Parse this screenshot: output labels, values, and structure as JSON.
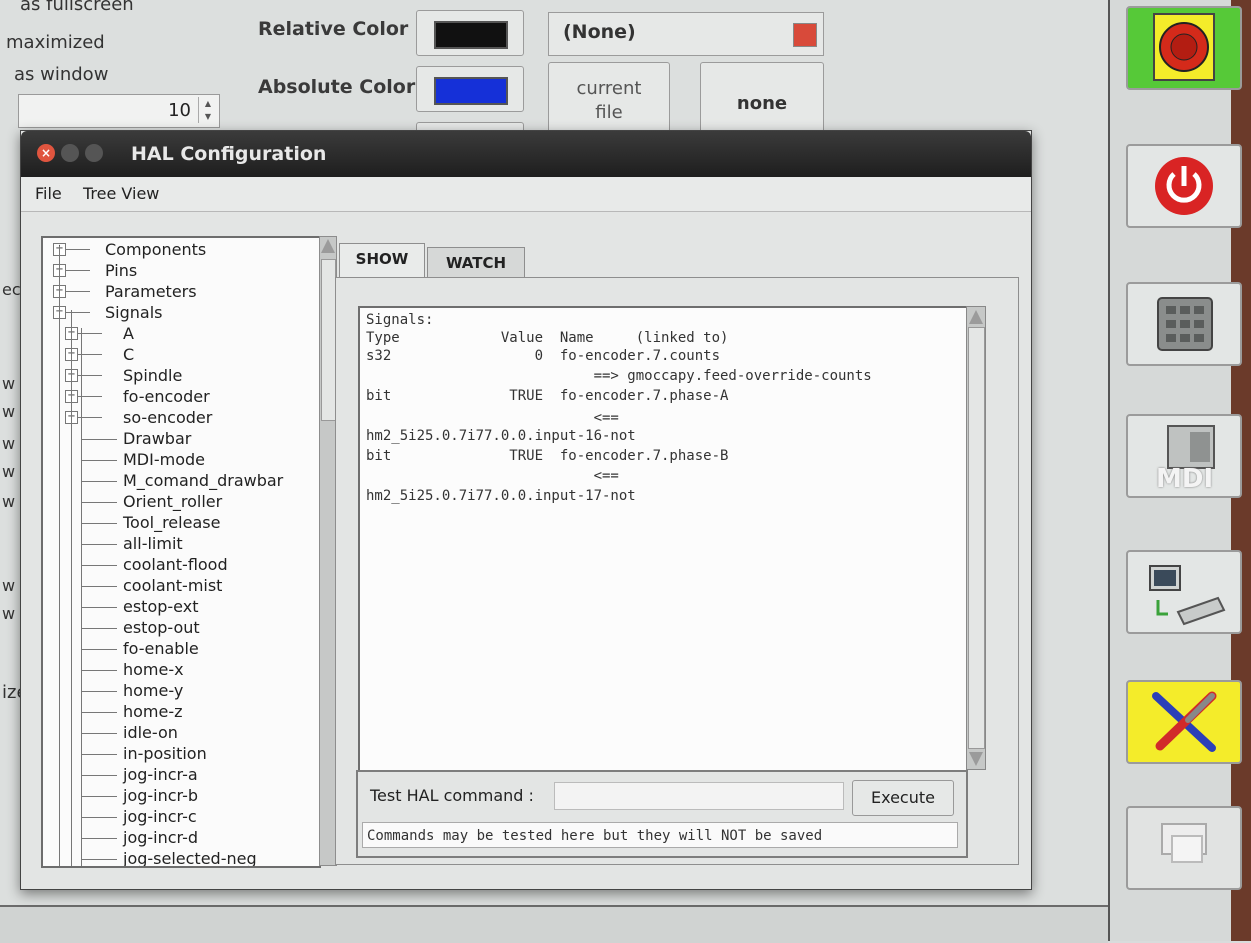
{
  "background": {
    "options": [
      "as fullscreen",
      "maximized",
      "as window"
    ],
    "spin_value": "10",
    "relative_color_label": "Relative Color",
    "absolute_color_label": "Absolute Color",
    "colors": {
      "relative": "#111111",
      "absolute": "#1530d8",
      "third": "#e8d622"
    },
    "combo_value": "(None)",
    "current_file_label": "current\nfile",
    "none_label": "none",
    "left_edge_fragments": [
      "ec",
      "w",
      "w",
      "w",
      "w",
      "w",
      "w",
      "w",
      "w",
      "ize"
    ],
    "toolbar": {
      "estop_label": "Emergency Stop",
      "mdi_label": "MDI",
      "colors": {
        "estop_bg": "#56c938",
        "settings_bg": "#f4ec2a",
        "power": "#d92424"
      }
    }
  },
  "hal": {
    "title": "HAL Configuration",
    "menu": [
      "File",
      "Tree View"
    ],
    "tree": {
      "top_level": [
        "Components",
        "Pins",
        "Parameters",
        "Signals"
      ],
      "signal_groups": [
        "A",
        "C",
        "Spindle",
        "fo-encoder",
        "so-encoder"
      ],
      "signals": [
        "Drawbar",
        "MDI-mode",
        "M_comand_drawbar",
        "Orient_roller",
        "Tool_release",
        "all-limit",
        "coolant-flood",
        "coolant-mist",
        "estop-ext",
        "estop-out",
        "fo-enable",
        "home-x",
        "home-y",
        "home-z",
        "idle-on",
        "in-position",
        "jog-incr-a",
        "jog-incr-b",
        "jog-incr-c",
        "jog-incr-d",
        "jog-selected-neg"
      ]
    },
    "tabs": [
      "SHOW",
      "WATCH"
    ],
    "active_tab": "SHOW",
    "output_lines": [
      "Signals:",
      "Type            Value  Name     (linked to)",
      "s32                 0  fo-encoder.7.counts",
      "                           ==> gmoccapy.feed-override-counts",
      "bit              TRUE  fo-encoder.7.phase-A",
      "                           <==",
      "hm2_5i25.0.7i77.0.0.input-16-not",
      "bit              TRUE  fo-encoder.7.phase-B",
      "                           <==",
      "hm2_5i25.0.7i77.0.0.input-17-not"
    ],
    "command": {
      "label": "Test HAL command :",
      "value": "",
      "execute_label": "Execute",
      "status": "Commands may be tested here but they will NOT be saved"
    }
  }
}
